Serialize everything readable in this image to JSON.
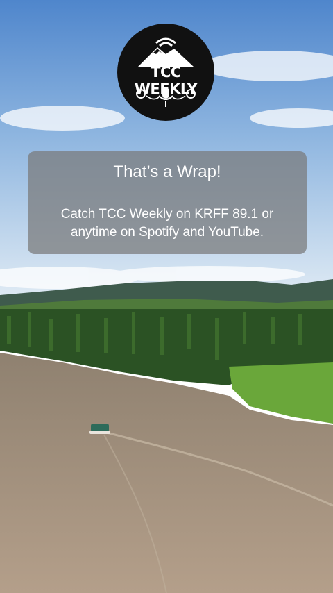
{
  "logo": {
    "title": "TCC WEEKLY",
    "icon": "podcast-mountain-logo"
  },
  "card": {
    "title": "That’s a Wrap!",
    "body": "Catch TCC Weekly on KRFF 89.1 or anytime on Spotify and YouTube."
  },
  "colors": {
    "sky_top": "#5b93d6",
    "sky_bottom": "#dbe8f3",
    "forest": "#2f5a2a",
    "river": "#a08e7b",
    "card_bg": "#787878"
  }
}
